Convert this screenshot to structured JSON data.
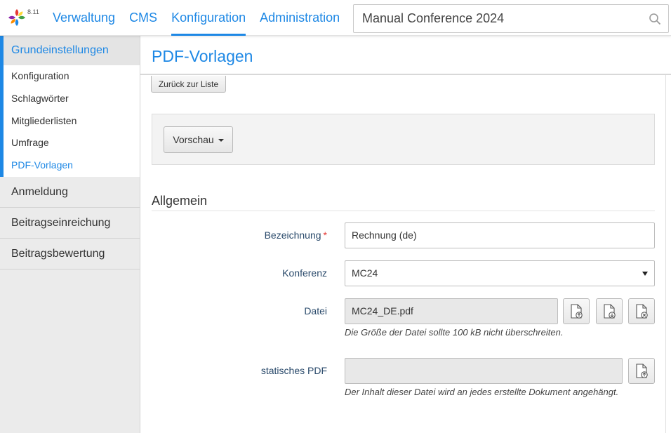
{
  "app": {
    "version": "8.11"
  },
  "nav": {
    "items": [
      {
        "label": "Verwaltung"
      },
      {
        "label": "CMS"
      },
      {
        "label": "Konfiguration"
      },
      {
        "label": "Administration"
      }
    ],
    "active_index": 2
  },
  "search": {
    "value": "Manual Conference 2024",
    "icon": "search-icon"
  },
  "sidebar": {
    "group": {
      "label": "Grundeinstellungen",
      "items": [
        {
          "label": "Konfiguration"
        },
        {
          "label": "Schlagwörter"
        },
        {
          "label": "Mitgliederlisten"
        },
        {
          "label": "Umfrage"
        },
        {
          "label": "PDF-Vorlagen"
        }
      ],
      "active_index": 4
    },
    "sections": [
      {
        "label": "Anmeldung"
      },
      {
        "label": "Beitragseinreichung"
      },
      {
        "label": "Beitragsbewertung"
      }
    ]
  },
  "main": {
    "title": "PDF-Vorlagen",
    "back_button": "Zurück zur Liste",
    "preview_button": "Vorschau",
    "section_title": "Allgemein",
    "form": {
      "bezeichnung": {
        "label": "Bezeichnung",
        "required_mark": "*",
        "value": "Rechnung (de)"
      },
      "konferenz": {
        "label": "Konferenz",
        "value": "MC24"
      },
      "datei": {
        "label": "Datei",
        "value": "MC24_DE.pdf",
        "hint": "Die Größe der Datei sollte 100 kB nicht überschreiten."
      },
      "statisches_pdf": {
        "label": "statisches PDF",
        "value": "",
        "hint": "Der Inhalt dieser Datei wird an jedes erstellte Dokument angehängt."
      }
    }
  },
  "colors": {
    "accent": "#1e88e5",
    "required": "#e53935"
  }
}
